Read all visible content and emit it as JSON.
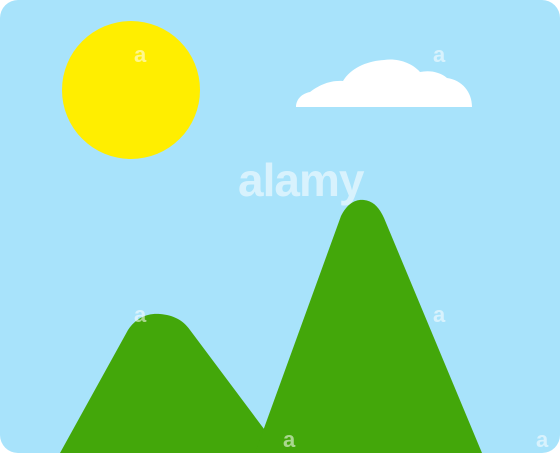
{
  "scene": {
    "description_free": true,
    "colors": {
      "sky": "#a8e3fb",
      "sun": "#ffee00",
      "cloud": "#ffffff",
      "mountain": "#43a70a",
      "frame_border": "#ffffff"
    }
  },
  "watermark": {
    "brand": "alamy",
    "mark": "a",
    "corner_mark": "a"
  }
}
